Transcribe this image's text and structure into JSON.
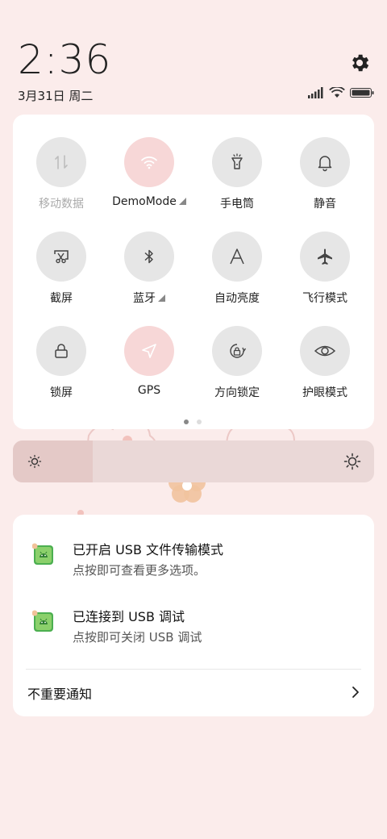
{
  "status": {
    "time": "2:36",
    "date": "3月31日 周二",
    "icons": [
      "signal-icon",
      "wifi-icon",
      "battery-icon"
    ]
  },
  "quick_settings": {
    "tiles": [
      {
        "label": "移动数据",
        "icon": "mobile-data-icon",
        "active": false,
        "disabled": true
      },
      {
        "label": "DemoMode",
        "icon": "wifi-icon",
        "active": true,
        "has_menu": true
      },
      {
        "label": "手电筒",
        "icon": "flashlight-icon",
        "active": false
      },
      {
        "label": "静音",
        "icon": "bell-icon",
        "active": false
      },
      {
        "label": "截屏",
        "icon": "screenshot-icon",
        "active": false
      },
      {
        "label": "蓝牙",
        "icon": "bluetooth-icon",
        "active": false,
        "has_menu": true
      },
      {
        "label": "自动亮度",
        "icon": "auto-brightness-icon",
        "active": false
      },
      {
        "label": "飞行模式",
        "icon": "airplane-icon",
        "active": false
      },
      {
        "label": "锁屏",
        "icon": "lock-icon",
        "active": false
      },
      {
        "label": "GPS",
        "icon": "gps-icon",
        "active": true
      },
      {
        "label": "方向锁定",
        "icon": "rotation-lock-icon",
        "active": false
      },
      {
        "label": "护眼模式",
        "icon": "eye-icon",
        "active": false
      }
    ],
    "page_indicator": {
      "current": 1,
      "total": 2
    }
  },
  "brightness": {
    "level": 0.22
  },
  "notifications": [
    {
      "title": "已开启 USB 文件传输模式",
      "subtitle": "点按即可查看更多选项。",
      "icon": "android-debug-icon"
    },
    {
      "title": "已连接到 USB 调试",
      "subtitle": "点按即可关闭 USB 调试",
      "icon": "android-debug-icon"
    }
  ],
  "unimportant_label": "不重要通知",
  "colors": {
    "accent": "#f7d7d7",
    "background": "#fbeceb",
    "android_green": "#4caf50"
  }
}
